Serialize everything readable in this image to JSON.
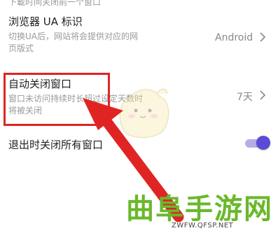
{
  "clipped_row": {
    "subtitle": "下載时间关闭前一个窗口"
  },
  "ua_row": {
    "title": "浏览器 UA 标识",
    "subtitle_line1": "切换UA后，网站将会提供对应的网",
    "subtitle_line2": "页版式",
    "value": "Android"
  },
  "auto_close_row": {
    "title": "自动关闭窗口",
    "subtitle_line1": "窗口未访问持续时长超过设定天数时",
    "subtitle_line2": "将被关闭",
    "value": "7天"
  },
  "exit_close_row": {
    "title": "退出时关闭所有窗口",
    "toggle_on": true
  },
  "watermark": {
    "brand": "曲阜手游网",
    "url": "ZWFW.QFSP.NET"
  },
  "colors": {
    "highlight": "#e02424",
    "toggle_accent": "#5b4bd6",
    "watermark_green": "#6ab82c"
  },
  "icons": [
    "chevron-right-icon",
    "chevron-right-icon",
    "annotation-arrow-icon",
    "mascot-icon"
  ]
}
